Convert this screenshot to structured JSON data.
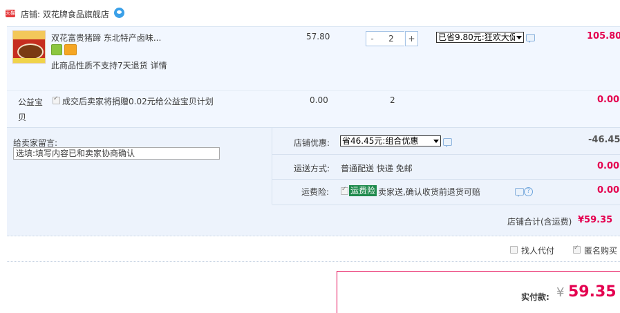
{
  "shop": {
    "name": "店铺: 双花牌食品旗舰店",
    "badge_text": "天猫"
  },
  "item": {
    "title": "双花富贵猪蹄 东北特产卤味...",
    "no_return_note": "此商品性质不支持7天退货 详情",
    "unit_price": "57.80",
    "quantity": "2",
    "minus_label": "-",
    "plus_label": "+",
    "promo_selected": "已省9.80元:狂欢大促",
    "subtotal": "105.80"
  },
  "charity": {
    "label": "公益宝贝",
    "text": "成交后卖家将捐赠0.02元给公益宝贝计划",
    "checked": true,
    "price": "0.00",
    "quantity": "2",
    "amount": "0.00"
  },
  "memo": {
    "label": "给卖家留言:",
    "placeholder": "选填:填写内容已和卖家协商确认"
  },
  "shop_discount": {
    "label": "店铺优惠:",
    "selected": "省46.45元:组合优惠",
    "amount": "-46.45"
  },
  "shipping": {
    "label": "运送方式:",
    "text": "普通配送 快递 免邮",
    "amount": "0.00"
  },
  "insurance": {
    "label": "运费险:",
    "badge": "运费险",
    "text": "卖家送,确认收货前退货可赔",
    "checked": true,
    "amount": "0.00"
  },
  "shop_total": {
    "label": "店铺合计(含运费)",
    "value": "¥59.35"
  },
  "options": {
    "proxy_pay": "找人代付",
    "anonymous": "匿名购买",
    "proxy_checked": false,
    "anonymous_checked": true
  },
  "payment": {
    "label": "实付款:",
    "currency": "¥",
    "amount": "59.35"
  },
  "colors": {
    "accent": "#e4004f",
    "panel": "#f2f7ff",
    "insurance_badge": "#1f8a4d"
  }
}
